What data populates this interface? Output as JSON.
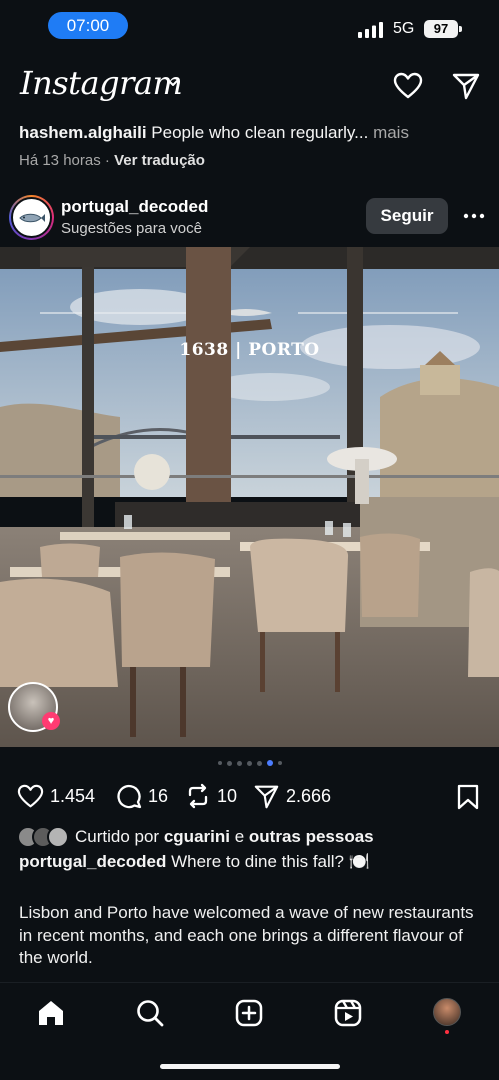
{
  "status_bar": {
    "time": "07:00",
    "network": "5G",
    "battery": "97"
  },
  "header": {
    "logo": "Instagram",
    "icons": [
      "chevron-down-icon",
      "heart-icon",
      "send-icon"
    ]
  },
  "previous_post": {
    "username": "hashem.alghaili",
    "caption": "People who clean regularly...",
    "more": "mais",
    "time": "Há 13 horas",
    "separator": "·",
    "translate": "Ver tradução"
  },
  "post": {
    "username": "portugal_decoded",
    "subtitle": "Sugestões para você",
    "follow_label": "Seguir",
    "image_overlay": "1638 | PORTO",
    "carousel": {
      "count": 7,
      "active": 5
    },
    "likes": "1.454",
    "comments": "16",
    "reposts": "10",
    "shares": "2.666",
    "liked_by_prefix": "Curtido por",
    "liked_by_user": "cguarini",
    "liked_by_join": "e",
    "liked_by_rest": "outras pessoas",
    "caption_user": "portugal_decoded",
    "caption_first": "Where to dine this fall? 🍽️",
    "caption_body": "Lisbon and Porto have welcomed a wave of new restaurants in recent months, and each one brings a different flavour of the world."
  },
  "nav": {
    "items": [
      "home-icon",
      "search-icon",
      "create-icon",
      "reels-icon",
      "profile-avatar"
    ]
  },
  "colors": {
    "background": "#0c1014",
    "accent": "#1f7cf5",
    "follow_button": "#363a3f",
    "active_dot": "#4c7dff"
  }
}
